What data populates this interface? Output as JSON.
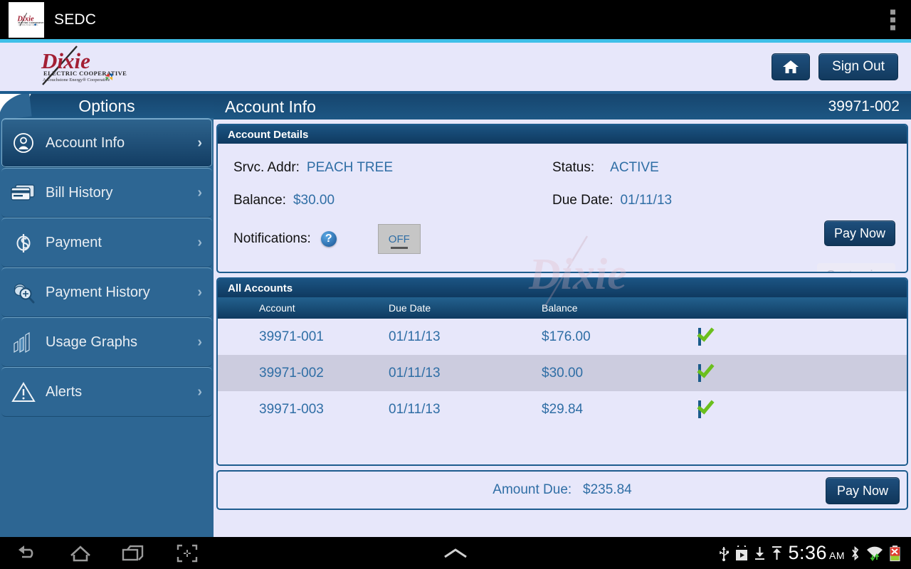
{
  "android": {
    "app_title": "SEDC",
    "overflow_label": "more-options",
    "nav": [
      "back",
      "home",
      "recents",
      "screenshot"
    ],
    "status": {
      "clock": "5:36",
      "ampm": "AM",
      "icons": [
        "usb-icon",
        "play-store-icon",
        "download-icon",
        "upload-icon",
        "bluetooth-icon",
        "wifi-icon",
        "battery-icon"
      ]
    }
  },
  "header": {
    "logo_name": "Dixie",
    "logo_sub1": "ELECTRIC COOPERATIVE",
    "logo_sub2": "A Touchstone Energy® Cooperative",
    "home_label": "Home",
    "signout_label": "Sign Out"
  },
  "sidebar": {
    "title": "Options",
    "items": [
      {
        "label": "Account Info",
        "icon": "user-circle-icon",
        "active": true
      },
      {
        "label": "Bill History",
        "icon": "credit-card-icon",
        "active": false
      },
      {
        "label": "Payment",
        "icon": "dollar-coin-icon",
        "active": false
      },
      {
        "label": "Payment History",
        "icon": "coin-search-icon",
        "active": false
      },
      {
        "label": "Usage Graphs",
        "icon": "bar-chart-icon",
        "active": false
      },
      {
        "label": "Alerts",
        "icon": "warning-triangle-icon",
        "active": false
      }
    ],
    "chevron": "›"
  },
  "page": {
    "title": "Account Info",
    "account_number": "39971-002",
    "watermark": "Dixie"
  },
  "account_details": {
    "panel_title": "Account Details",
    "srvc_addr_label": "Srvc. Addr:",
    "srvc_addr_value": "PEACH TREE",
    "balance_label": "Balance:",
    "balance_value": "$30.00",
    "notifications_label": "Notifications:",
    "help_glyph": "?",
    "toggle_state": "OFF",
    "status_label": "Status:",
    "status_value": "ACTIVE",
    "due_date_label": "Due Date:",
    "due_date_value": "01/11/13",
    "pay_now_label": "Pay Now",
    "customize_label": "Customize"
  },
  "all_accounts": {
    "panel_title": "All Accounts",
    "columns": [
      "Account",
      "Due Date",
      "Balance",
      ""
    ],
    "rows": [
      {
        "account": "39971-001",
        "due_date": "01/11/13",
        "balance": "$176.00",
        "checked": true,
        "selected": false
      },
      {
        "account": "39971-002",
        "due_date": "01/11/13",
        "balance": "$30.00",
        "checked": true,
        "selected": true
      },
      {
        "account": "39971-003",
        "due_date": "01/11/13",
        "balance": "$29.84",
        "checked": true,
        "selected": false
      }
    ],
    "amount_due_label": "Amount Due:",
    "amount_due_value": "$235.84",
    "pay_now_label": "Pay Now"
  },
  "colors": {
    "status_bar": "#000000",
    "cyan_accent": "#3fc0e8",
    "lavender": "#e7e7fa",
    "sidebar": "#2d6693",
    "panel_header_dark": "#0f3a60",
    "link_blue": "#2f6ea5",
    "check_green": "#6bbf1d",
    "selected_row": "#ccccdf"
  }
}
